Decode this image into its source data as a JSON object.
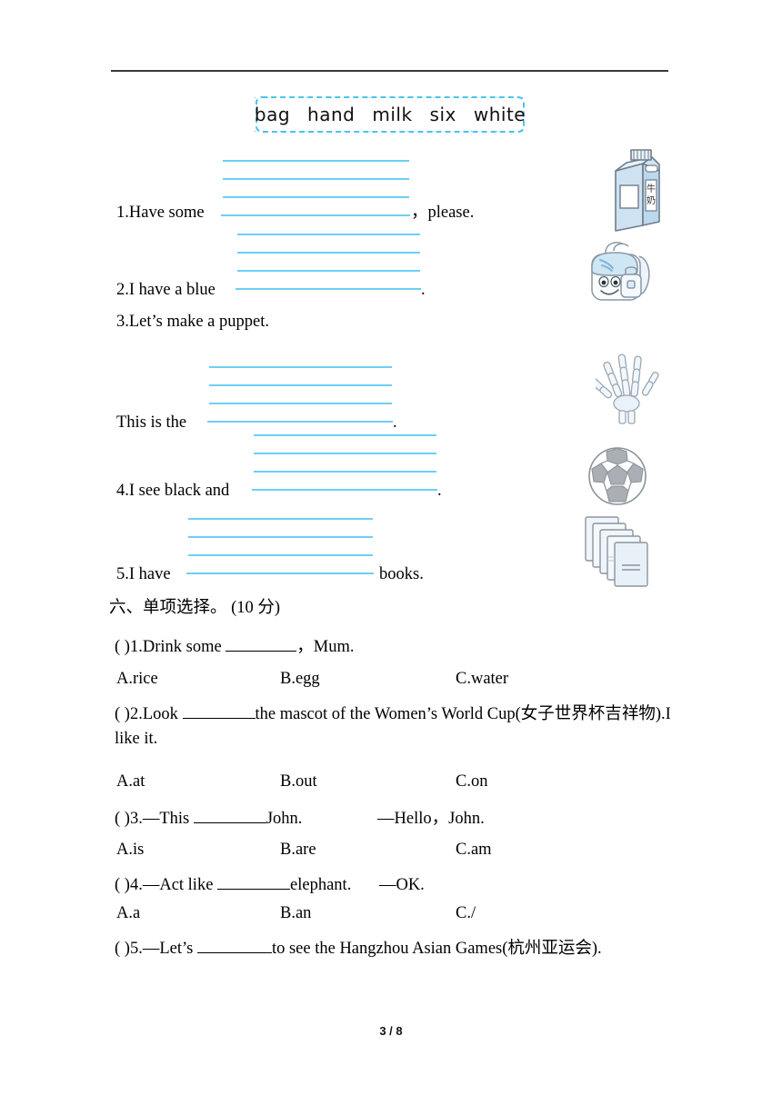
{
  "page": {
    "footer": "3 / 8"
  },
  "word_bank": {
    "words": [
      "bag",
      "hand",
      "milk",
      "six",
      "white"
    ]
  },
  "fill_in_section": {
    "items": [
      {
        "number": "1.Have some",
        "tail": "，please."
      },
      {
        "number": "2.I have a blue",
        "tail": "."
      },
      {
        "number": "3.Let’s make a puppet.",
        "tail": ""
      },
      {
        "number": "This is the",
        "tail": "."
      },
      {
        "number": "4.I see black and",
        "tail": "."
      },
      {
        "number": "5.I have",
        "tail": "books."
      }
    ]
  },
  "multiple_choice": {
    "heading": "六、单项选择。 (10 分)",
    "questions": [
      {
        "paren": "(      )",
        "stem_before": "1.Drink some",
        "stem_after": "，Mum.",
        "a": "A.rice",
        "b": "B.egg",
        "c": "C.water"
      },
      {
        "paren": "(      )",
        "stem_before": "2.Look",
        "stem_after": "the mascot of the Women’s World Cup(女子世界杯吉祥物).I like it.",
        "a": "A.at",
        "b": "B.out",
        "c": "C.on"
      },
      {
        "paren": "(      )",
        "stem_before": "3.—This",
        "stem_after": "John.",
        "reply": "—Hello，John.",
        "a": "A.is",
        "b": "B.are",
        "c": "C.am"
      },
      {
        "paren": "(      )",
        "stem_before": "4.—Act like",
        "stem_after": "elephant.",
        "reply": "—OK.",
        "a": "A.a",
        "b": "B.an",
        "c": "C./"
      },
      {
        "paren": "(      )",
        "stem_before": "5.—Let’s",
        "stem_after": "to see the Hangzhou Asian Games(杭州亚运会).",
        "a": "",
        "b": "",
        "c": ""
      }
    ]
  },
  "illustrations": [
    {
      "name": "milk-carton",
      "label": "牛奶"
    },
    {
      "name": "backpack",
      "label": ""
    },
    {
      "name": "hand-xray",
      "label": ""
    },
    {
      "name": "soccer-ball",
      "label": ""
    },
    {
      "name": "stack-of-books",
      "label": ""
    }
  ],
  "colors": {
    "rule": "#3a3a3a",
    "writing_line": "#6ecff5",
    "bank_border": "#4cc3ef",
    "illustration_fill": "#dce9f5",
    "illustration_stroke": "#7f8c98"
  }
}
